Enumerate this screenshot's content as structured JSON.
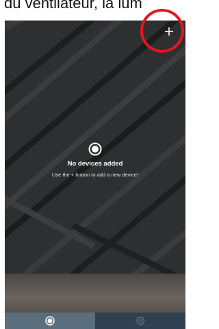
{
  "caption": {
    "text": "du ventilateur, la lum"
  },
  "header": {
    "add_icon": "plus-icon"
  },
  "empty_state": {
    "icon": "circle-radio-icon",
    "title": "No devices added",
    "hint": "Use the + button to add a new device!"
  },
  "tabbar": {
    "tabs": [
      {
        "icon": "devices-circle-icon",
        "active": true
      },
      {
        "icon": "gear-icon",
        "active": false
      }
    ]
  },
  "colors": {
    "annotation": "#e8141c",
    "tab_active": "#5b6e7d",
    "tab_inactive": "#2f4150",
    "wall": "#2e2f31"
  }
}
